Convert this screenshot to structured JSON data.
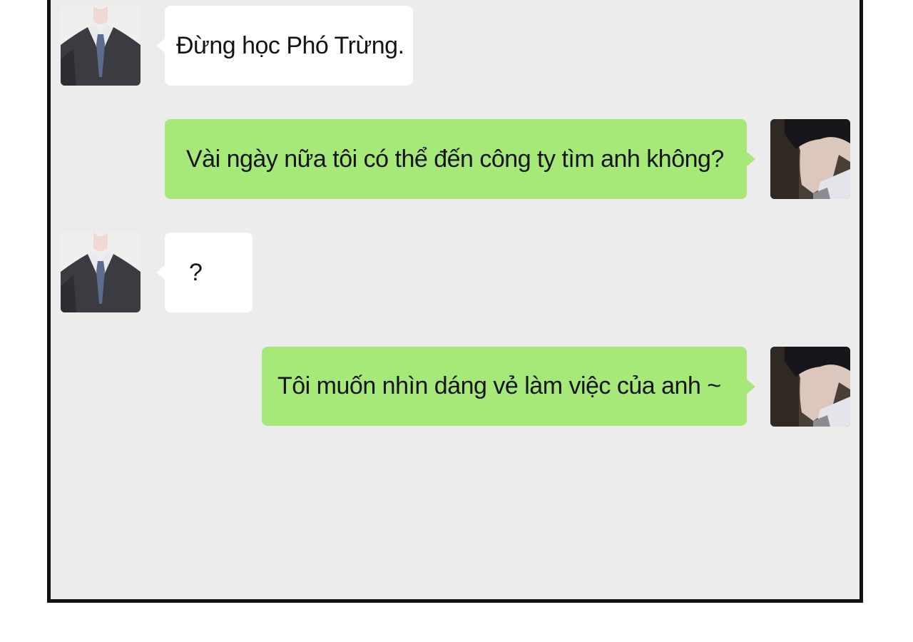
{
  "chat": {
    "messages": [
      {
        "side": "incoming",
        "text": "Đừng học Phó Trừng.",
        "avatar": "suit-man-avatar"
      },
      {
        "side": "outgoing",
        "text": "Vài ngày nữa tôi có thể đến công ty tìm anh không?",
        "avatar": "dark-hair-man-avatar"
      },
      {
        "side": "incoming",
        "text": "?",
        "avatar": "suit-man-avatar"
      },
      {
        "side": "outgoing",
        "text": "Tôi muốn nhìn dáng vẻ làm việc của anh ~",
        "avatar": "dark-hair-man-avatar"
      }
    ]
  },
  "colors": {
    "background": "#ececec",
    "incoming_bubble": "#ffffff",
    "outgoing_bubble": "#a6e978",
    "frame_border": "#111111"
  }
}
